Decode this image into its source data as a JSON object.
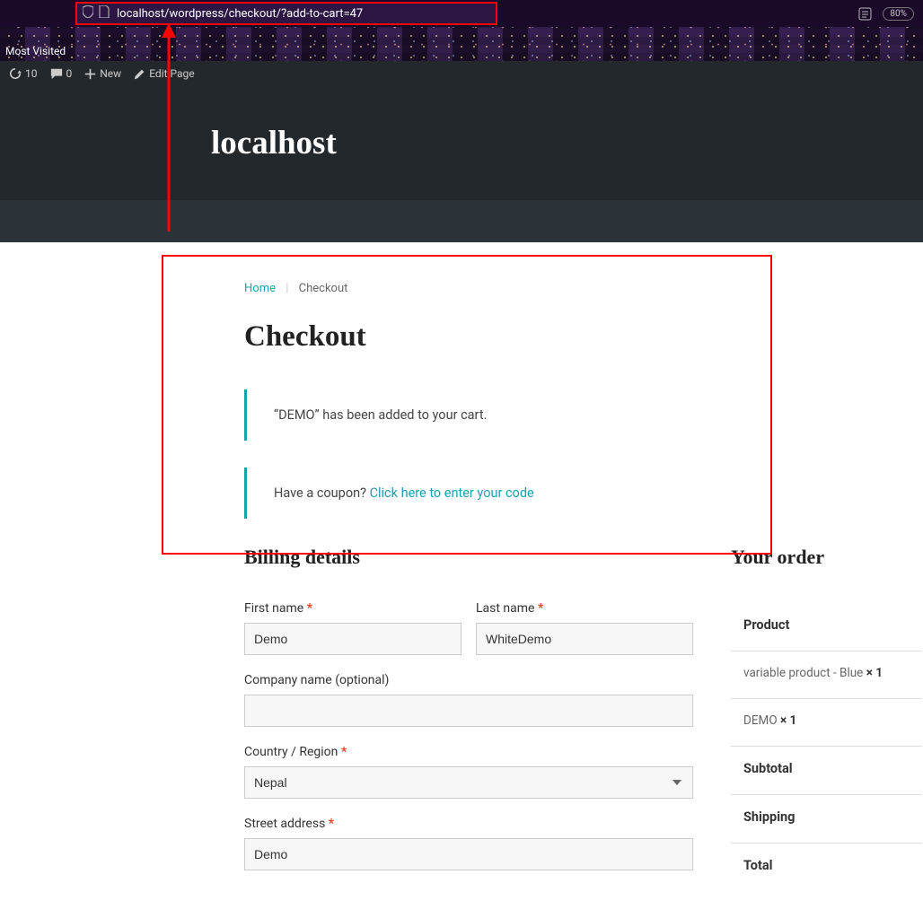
{
  "browser": {
    "url": "localhost/wordpress/checkout/?add-to-cart=47",
    "zoom": "80%",
    "most_visited": "Most Visited"
  },
  "admin_bar": {
    "updates": "10",
    "comments": "0",
    "new": "New",
    "edit": "Edit Page"
  },
  "site": {
    "title": "localhost"
  },
  "breadcrumb": {
    "home": "Home",
    "current": "Checkout"
  },
  "page": {
    "title": "Checkout"
  },
  "notices": {
    "added": "“DEMO” has been added to your cart.",
    "coupon_prompt": "Have a coupon? ",
    "coupon_link": "Click here to enter your code"
  },
  "billing": {
    "heading": "Billing details",
    "first_name_label": "First name ",
    "first_name_value": "Demo",
    "last_name_label": "Last name ",
    "last_name_value": "WhiteDemo",
    "company_label": "Company name (optional)",
    "company_value": "",
    "country_label": "Country / Region ",
    "country_value": "Nepal",
    "street_label": "Street address ",
    "street_value": "Demo"
  },
  "order": {
    "heading": "Your order",
    "product_header": "Product",
    "items": [
      {
        "name": "variable product - Blue ",
        "qty": "× 1"
      },
      {
        "name": "DEMO ",
        "qty": "× 1"
      }
    ],
    "subtotal": "Subtotal",
    "shipping": "Shipping",
    "total": "Total"
  }
}
